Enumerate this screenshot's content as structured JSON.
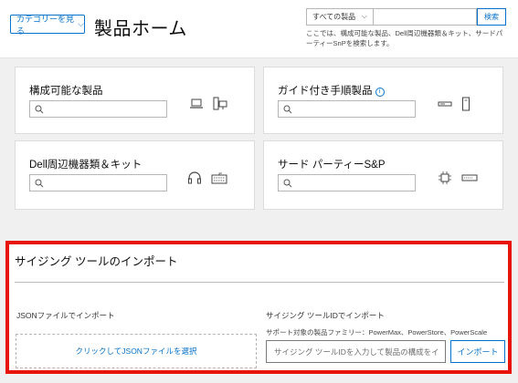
{
  "header": {
    "category_button": "カテゴリーを見る",
    "title": "製品ホーム",
    "search": {
      "scope": "すべての製品",
      "placeholder": "",
      "button": "検索",
      "hint": "ここでは、構成可能な製品、Dell周辺機器類＆キット、サードパーティーSnPを検索します。"
    }
  },
  "cards": [
    {
      "title": "構成可能な製品",
      "icons": [
        "laptop-icon",
        "desktop-icon"
      ]
    },
    {
      "title": "ガイド付き手順製品",
      "icons": [
        "server-icon",
        "tower-icon"
      ],
      "info": "i"
    },
    {
      "title": "Dell周辺機器類＆キット",
      "icons": [
        "headset-icon",
        "keyboard-icon"
      ]
    },
    {
      "title": "サード パーティーS&P",
      "icons": [
        "chip-icon",
        "drive-icon"
      ]
    }
  ],
  "import": {
    "title": "サイジング ツールのインポート",
    "json_label": "JSONファイルでインポート",
    "file_button": "クリックしてJSONファイルを選択",
    "id_label": "サイジング ツールIDでインポート",
    "family_label": "サポート対象の製品ファミリー：PowerMax、PowerStore、PowerScale",
    "id_placeholder": "サイジング ツールIDを入力して製品の構成をイ",
    "import_button": "インポート"
  },
  "colors": {
    "accent": "#0672cb",
    "highlight_border": "#e8140a",
    "background": "#f0f0f0"
  }
}
